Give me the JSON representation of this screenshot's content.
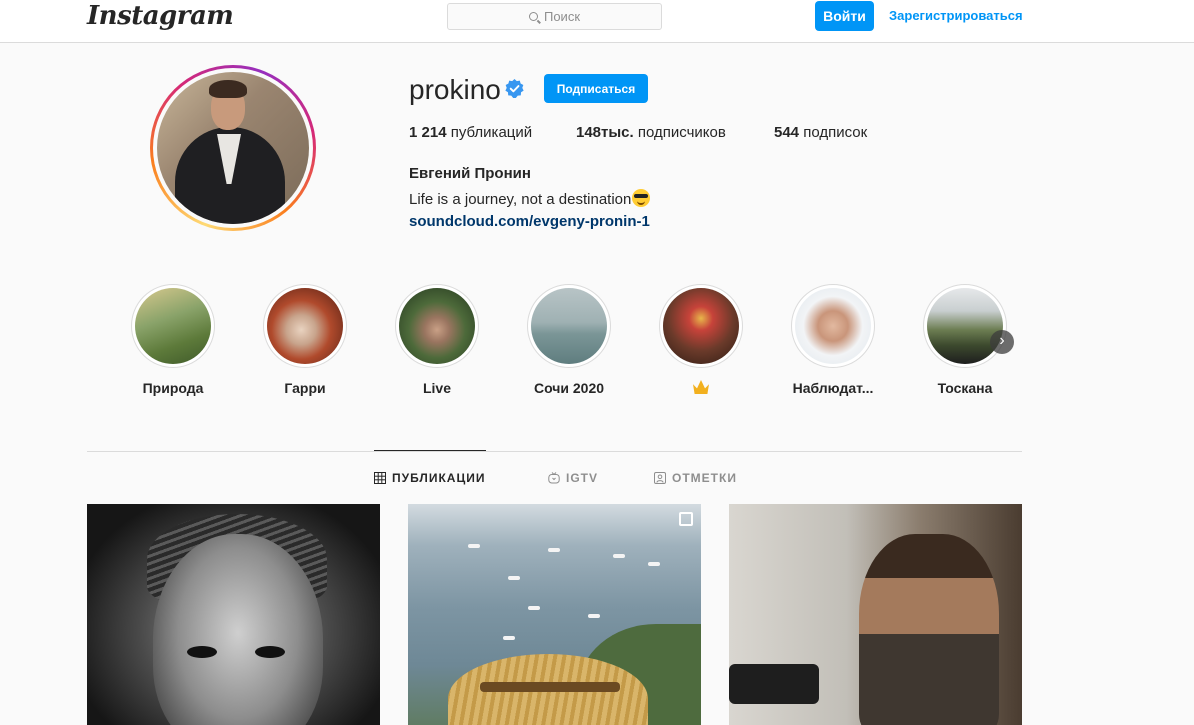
{
  "header": {
    "logo": "Instagram",
    "search_placeholder": "Поиск",
    "login_label": "Войти",
    "signup_label": "Зарегистрироваться"
  },
  "profile": {
    "username": "prokino",
    "follow_label": "Подписаться",
    "posts_count": "1 214",
    "posts_label": " публикаций",
    "followers_count": "148тыс.",
    "followers_label": " подписчиков",
    "following_count": "544",
    "following_label": " подписок",
    "full_name": "Евгений Пронин",
    "bio": "Life is a journey, not a destination",
    "link": "soundcloud.com/evgeny-pronin-1"
  },
  "highlights": [
    {
      "label": "Природа"
    },
    {
      "label": "Гарри"
    },
    {
      "label": "Live"
    },
    {
      "label": "Сочи 2020"
    },
    {
      "label": ""
    },
    {
      "label": "Наблюдат..."
    },
    {
      "label": "Тоскана"
    }
  ],
  "tabs": {
    "posts": "ПУБЛИКАЦИИ",
    "igtv": "IGTV",
    "tagged": "ОТМЕТКИ"
  },
  "colors": {
    "accent": "#0095f6",
    "link": "#00376b",
    "text": "#262626",
    "muted": "#8e8e8e"
  }
}
